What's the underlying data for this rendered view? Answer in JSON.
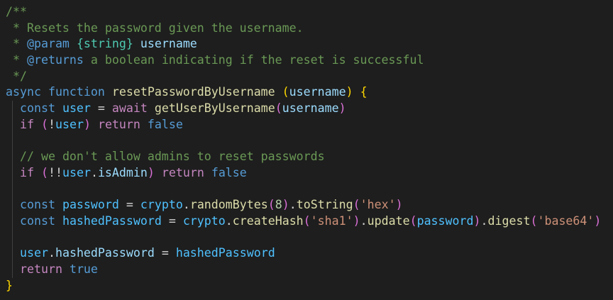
{
  "colors": {
    "background": "#1e1e1e",
    "comment": "#6a9955",
    "keyword": "#569cd6",
    "control": "#c586c0",
    "function": "#dcdcaa",
    "variable": "#9cdcfe",
    "string": "#ce9178",
    "number": "#b5cea8",
    "bracket_gold": "#ffd700",
    "bracket_orchid": "#da70d6",
    "bracket_blue": "#179fff"
  },
  "code": {
    "lines": [
      {
        "indent": 0,
        "tokens": [
          {
            "t": "/**",
            "c": "comment"
          }
        ]
      },
      {
        "indent": 0,
        "tokens": [
          {
            "t": " * Resets the password given the username.",
            "c": "comment"
          }
        ]
      },
      {
        "indent": 0,
        "tokens": [
          {
            "t": " * ",
            "c": "comment"
          },
          {
            "t": "@param",
            "c": "doctag"
          },
          {
            "t": " ",
            "c": "comment"
          },
          {
            "t": "{string}",
            "c": "doctype"
          },
          {
            "t": " ",
            "c": "comment"
          },
          {
            "t": "username",
            "c": "docname"
          }
        ]
      },
      {
        "indent": 0,
        "tokens": [
          {
            "t": " * ",
            "c": "comment"
          },
          {
            "t": "@returns",
            "c": "doctag"
          },
          {
            "t": " a boolean indicating if the reset is successful",
            "c": "comment"
          }
        ]
      },
      {
        "indent": 0,
        "tokens": [
          {
            "t": " */",
            "c": "comment"
          }
        ]
      },
      {
        "indent": 0,
        "tokens": [
          {
            "t": "async",
            "c": "keyword"
          },
          {
            "t": " ",
            "c": "punct"
          },
          {
            "t": "function",
            "c": "keyword"
          },
          {
            "t": " ",
            "c": "punct"
          },
          {
            "t": "resetPasswordByUsername",
            "c": "func"
          },
          {
            "t": " ",
            "c": "punct"
          },
          {
            "t": "(",
            "c": "brace1"
          },
          {
            "t": "username",
            "c": "var"
          },
          {
            "t": ")",
            "c": "brace1"
          },
          {
            "t": " ",
            "c": "punct"
          },
          {
            "t": "{",
            "c": "brace1"
          }
        ]
      },
      {
        "indent": 1,
        "tokens": [
          {
            "t": "const",
            "c": "keyword"
          },
          {
            "t": " ",
            "c": "punct"
          },
          {
            "t": "user",
            "c": "const"
          },
          {
            "t": " = ",
            "c": "punct"
          },
          {
            "t": "await",
            "c": "control"
          },
          {
            "t": " ",
            "c": "punct"
          },
          {
            "t": "getUserByUsername",
            "c": "func"
          },
          {
            "t": "(",
            "c": "brace2"
          },
          {
            "t": "username",
            "c": "var"
          },
          {
            "t": ")",
            "c": "brace2"
          }
        ]
      },
      {
        "indent": 1,
        "tokens": [
          {
            "t": "if",
            "c": "control"
          },
          {
            "t": " ",
            "c": "punct"
          },
          {
            "t": "(",
            "c": "brace2"
          },
          {
            "t": "!",
            "c": "punct"
          },
          {
            "t": "user",
            "c": "const"
          },
          {
            "t": ")",
            "c": "brace2"
          },
          {
            "t": " ",
            "c": "punct"
          },
          {
            "t": "return",
            "c": "control"
          },
          {
            "t": " ",
            "c": "punct"
          },
          {
            "t": "false",
            "c": "keyword"
          }
        ]
      },
      {
        "indent": 1,
        "tokens": []
      },
      {
        "indent": 1,
        "tokens": [
          {
            "t": "// we don't allow admins to reset passwords",
            "c": "comment"
          }
        ]
      },
      {
        "indent": 1,
        "tokens": [
          {
            "t": "if",
            "c": "control"
          },
          {
            "t": " ",
            "c": "punct"
          },
          {
            "t": "(",
            "c": "brace2"
          },
          {
            "t": "!!",
            "c": "punct"
          },
          {
            "t": "user",
            "c": "const"
          },
          {
            "t": ".",
            "c": "punct"
          },
          {
            "t": "isAdmin",
            "c": "var"
          },
          {
            "t": ")",
            "c": "brace2"
          },
          {
            "t": " ",
            "c": "punct"
          },
          {
            "t": "return",
            "c": "control"
          },
          {
            "t": " ",
            "c": "punct"
          },
          {
            "t": "false",
            "c": "keyword"
          }
        ]
      },
      {
        "indent": 1,
        "tokens": []
      },
      {
        "indent": 1,
        "tokens": [
          {
            "t": "const",
            "c": "keyword"
          },
          {
            "t": " ",
            "c": "punct"
          },
          {
            "t": "password",
            "c": "const"
          },
          {
            "t": " = ",
            "c": "punct"
          },
          {
            "t": "crypto",
            "c": "const"
          },
          {
            "t": ".",
            "c": "punct"
          },
          {
            "t": "randomBytes",
            "c": "func"
          },
          {
            "t": "(",
            "c": "brace2"
          },
          {
            "t": "8",
            "c": "number"
          },
          {
            "t": ")",
            "c": "brace2"
          },
          {
            "t": ".",
            "c": "punct"
          },
          {
            "t": "toString",
            "c": "func"
          },
          {
            "t": "(",
            "c": "brace2"
          },
          {
            "t": "'hex'",
            "c": "string"
          },
          {
            "t": ")",
            "c": "brace2"
          }
        ]
      },
      {
        "indent": 1,
        "tokens": [
          {
            "t": "const",
            "c": "keyword"
          },
          {
            "t": " ",
            "c": "punct"
          },
          {
            "t": "hashedPassword",
            "c": "const"
          },
          {
            "t": " = ",
            "c": "punct"
          },
          {
            "t": "crypto",
            "c": "const"
          },
          {
            "t": ".",
            "c": "punct"
          },
          {
            "t": "createHash",
            "c": "func"
          },
          {
            "t": "(",
            "c": "brace2"
          },
          {
            "t": "'sha1'",
            "c": "string"
          },
          {
            "t": ")",
            "c": "brace2"
          },
          {
            "t": ".",
            "c": "punct"
          },
          {
            "t": "update",
            "c": "func"
          },
          {
            "t": "(",
            "c": "brace2"
          },
          {
            "t": "password",
            "c": "const"
          },
          {
            "t": ")",
            "c": "brace2"
          },
          {
            "t": ".",
            "c": "punct"
          },
          {
            "t": "digest",
            "c": "func"
          },
          {
            "t": "(",
            "c": "brace2"
          },
          {
            "t": "'base64'",
            "c": "string"
          },
          {
            "t": ")",
            "c": "brace2"
          }
        ]
      },
      {
        "indent": 1,
        "tokens": []
      },
      {
        "indent": 1,
        "tokens": [
          {
            "t": "user",
            "c": "const"
          },
          {
            "t": ".",
            "c": "punct"
          },
          {
            "t": "hashedPassword",
            "c": "var"
          },
          {
            "t": " = ",
            "c": "punct"
          },
          {
            "t": "hashedPassword",
            "c": "const"
          }
        ]
      },
      {
        "indent": 1,
        "tokens": [
          {
            "t": "return",
            "c": "control"
          },
          {
            "t": " ",
            "c": "punct"
          },
          {
            "t": "true",
            "c": "keyword"
          }
        ]
      },
      {
        "indent": 0,
        "tokens": [
          {
            "t": "}",
            "c": "brace1"
          }
        ]
      }
    ]
  }
}
